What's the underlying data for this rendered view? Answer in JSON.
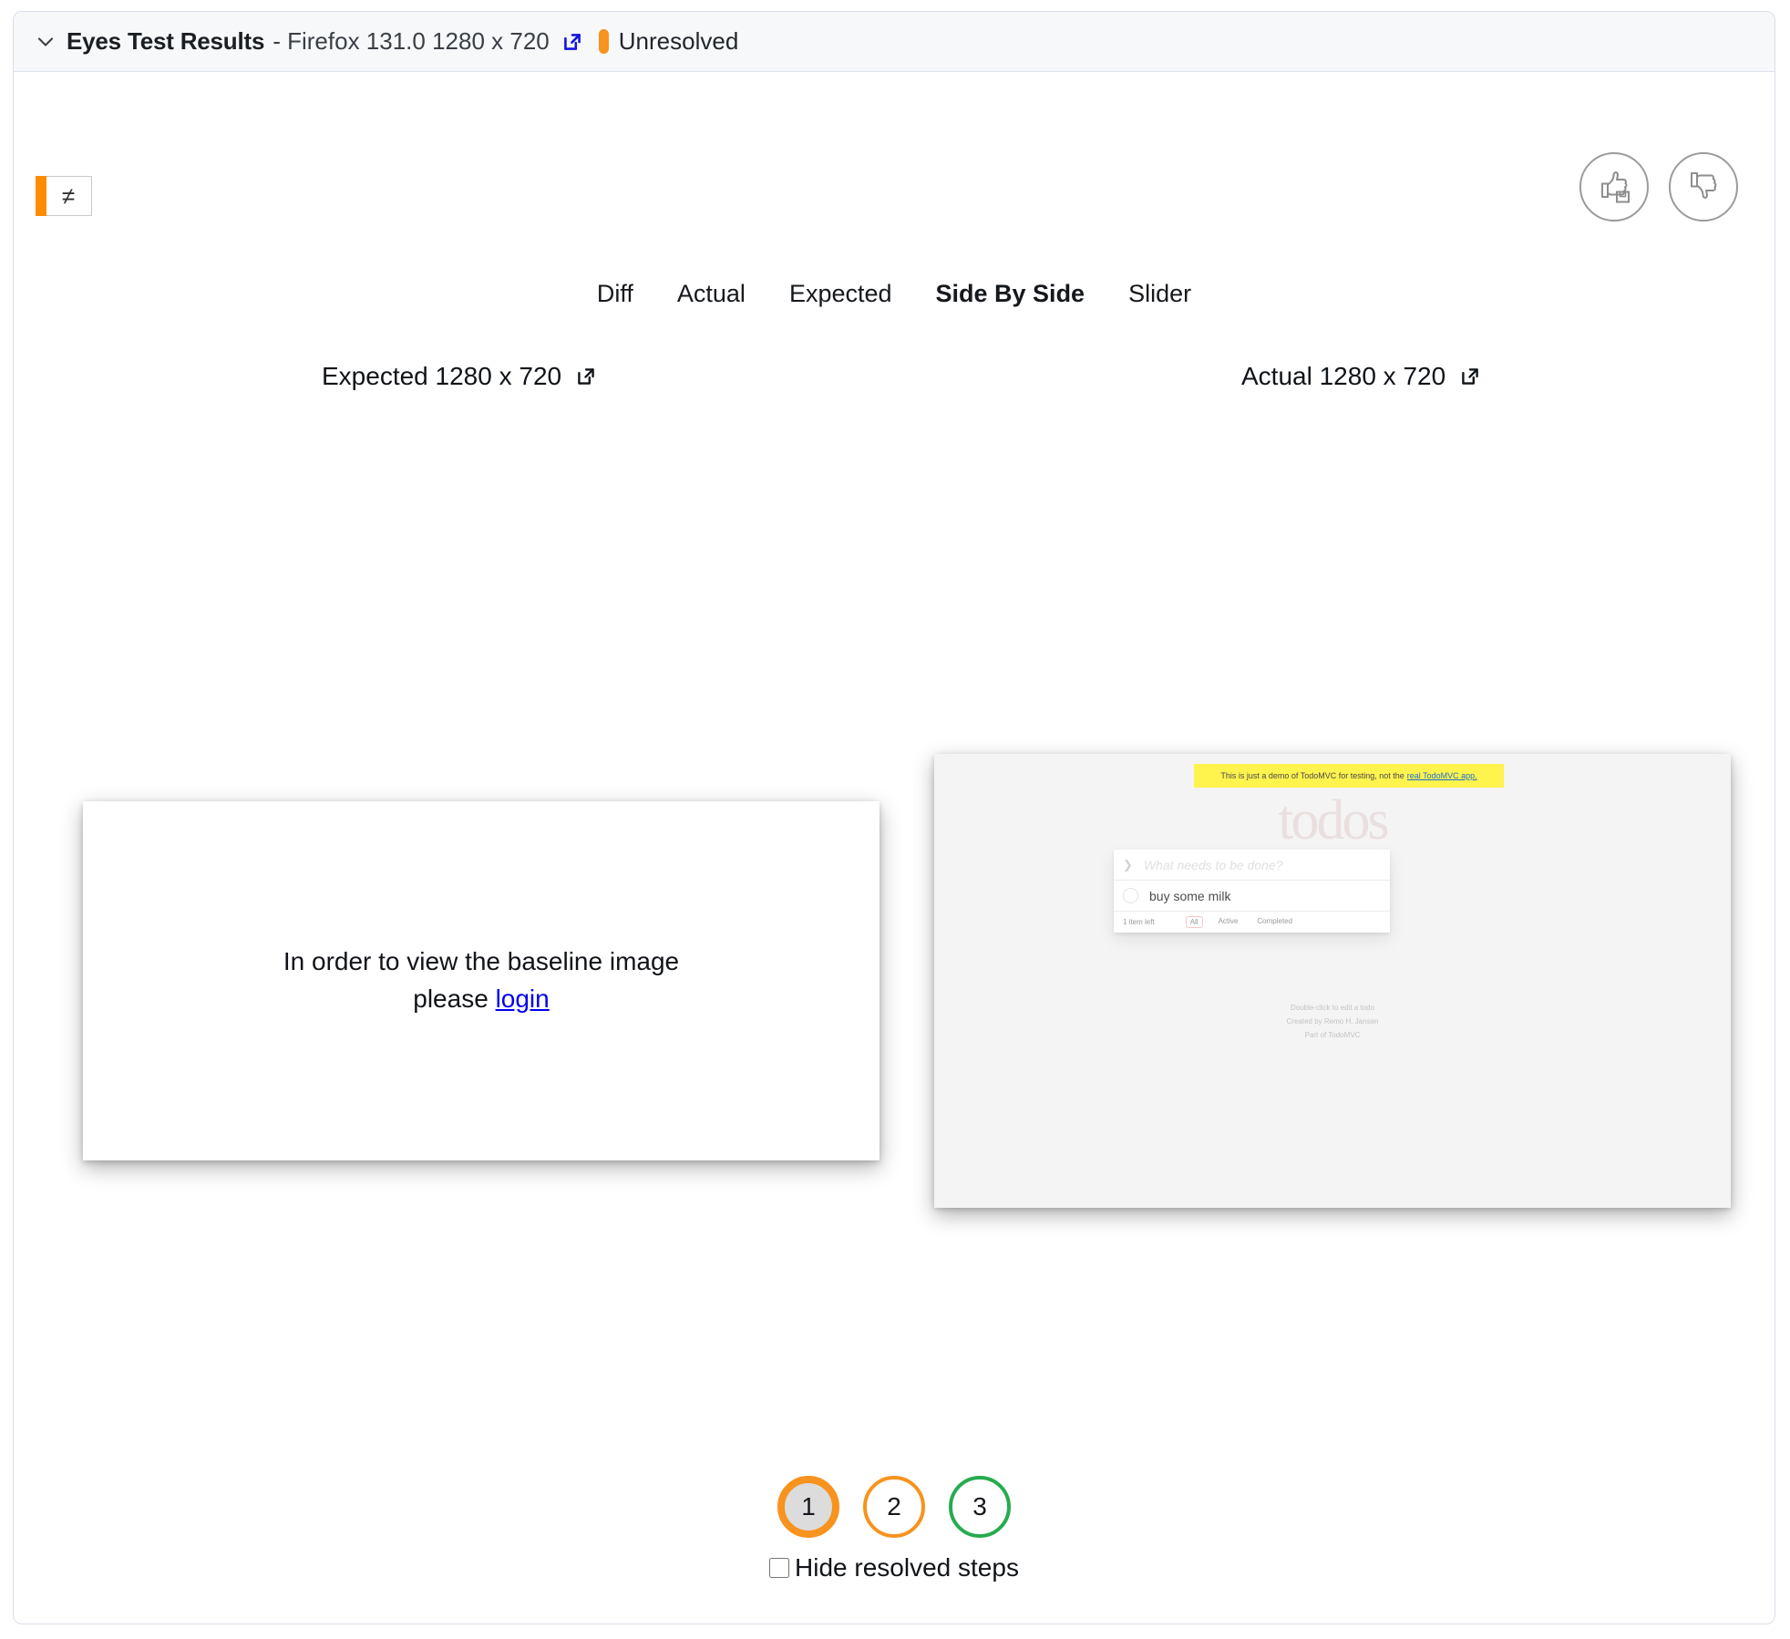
{
  "header": {
    "chevron_icon": "chevron-down-icon",
    "title": "Eyes Test Results",
    "subtitle": "- Firefox 131.0 1280 x 720",
    "external_link_icon": "external-link-icon",
    "status": "Unresolved",
    "status_color": "#f7931e"
  },
  "toolbar": {
    "diff_toggle_label": "≠",
    "diff_toggle_accent": "#ff8c00",
    "thumbs_up_icon": "thumbs-up-save-icon",
    "thumbs_down_icon": "thumbs-down-icon"
  },
  "tabs": [
    {
      "label": "Diff",
      "active": false
    },
    {
      "label": "Actual",
      "active": false
    },
    {
      "label": "Expected",
      "active": false
    },
    {
      "label": "Side By Side",
      "active": true
    },
    {
      "label": "Slider",
      "active": false
    }
  ],
  "panels": {
    "expected": {
      "label": "Expected 1280 x 720",
      "external_link_icon": "external-link-icon",
      "message_line1": "In order to view the baseline image",
      "message_line2_prefix": "please ",
      "login_link": "login"
    },
    "actual": {
      "label": "Actual 1280 x 720",
      "external_link_icon": "external-link-icon",
      "screenshot": {
        "banner_text": "This is just a demo of TodoMVC for testing, not the",
        "banner_link": "real TodoMVC app.",
        "app_title": "todos",
        "new_todo_placeholder": "What needs to be done?",
        "toggle_all_icon": "chevron-down-icon",
        "items": [
          {
            "text": "buy some milk",
            "completed": false
          }
        ],
        "count_label": "1 item left",
        "filters": [
          {
            "label": "All",
            "selected": true
          },
          {
            "label": "Active",
            "selected": false
          },
          {
            "label": "Completed",
            "selected": false
          }
        ],
        "info_lines": [
          "Double-click to edit a todo",
          "Created by Remo H. Jansen",
          "Part of TodoMVC"
        ]
      }
    }
  },
  "steps": {
    "items": [
      {
        "number": "1",
        "state": "orange",
        "selected": true
      },
      {
        "number": "2",
        "state": "orange",
        "selected": false
      },
      {
        "number": "3",
        "state": "green",
        "selected": false
      }
    ],
    "colors": {
      "orange": "#f7931e",
      "green": "#27ab4f",
      "selected_fill": "#dcdcdc"
    }
  },
  "hide_resolved": {
    "label": "Hide resolved steps",
    "checked": false
  }
}
